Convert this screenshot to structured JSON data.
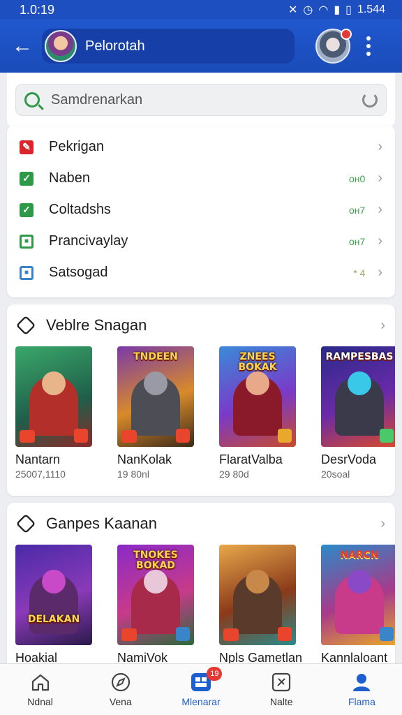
{
  "status_bar": {
    "time": "1.0:19",
    "right_text": "1.544"
  },
  "app_bar": {
    "title": "Pelorotah"
  },
  "search": {
    "placeholder": "Samdrenarkan"
  },
  "menu": [
    {
      "label": "Pekrigan",
      "count": "",
      "icon": "red-pencil-icon",
      "color": "#d9262c"
    },
    {
      "label": "Naben",
      "count": "oн0",
      "icon": "green-check-icon",
      "color": "#2e9a48"
    },
    {
      "label": "Coltadshs",
      "count": "oн7",
      "icon": "green-check-icon",
      "color": "#2e9a48"
    },
    {
      "label": "Prancivaylay",
      "count": "oн7",
      "icon": "green-square-icon",
      "color": "#2e9a48"
    },
    {
      "label": "Satsogad",
      "count": "* 4",
      "icon": "blue-square-icon",
      "color": "#3a84c9"
    }
  ],
  "section1": {
    "title": "Veblre Snagan",
    "games": [
      {
        "name": "Nantarn",
        "meta": "25007,1110",
        "caption": ""
      },
      {
        "name": "NanKolak",
        "meta": "19 80nl",
        "caption": "TNDEEN"
      },
      {
        "name": "FlaratValba",
        "meta": "29 80d",
        "caption": "ZNEES BOKAK"
      },
      {
        "name": "DesrVoda",
        "meta": "20soal",
        "caption": "RAMPESBAS"
      }
    ]
  },
  "section2": {
    "title": "Ganpes Kaanan",
    "games": [
      {
        "name": "Hoakial",
        "caption": "DELAKAN"
      },
      {
        "name": "NamiVok",
        "caption": "TNOKES BOKAD"
      },
      {
        "name": "Npls Gametlan",
        "caption": ""
      },
      {
        "name": "Kannlaloant",
        "caption": "NARCN"
      }
    ]
  },
  "bottom_nav": [
    {
      "label": "Ndnal",
      "icon": "home-icon"
    },
    {
      "label": "Vena",
      "icon": "compass-icon"
    },
    {
      "label": "Mlenarar",
      "icon": "games-icon",
      "badge": "19"
    },
    {
      "label": "Nalte",
      "icon": "tool-icon"
    },
    {
      "label": "Flama",
      "icon": "person-icon"
    }
  ],
  "colors": {
    "primary": "#1e4fc0",
    "accent": "#1e5fd0",
    "check": "#2e9a48"
  }
}
